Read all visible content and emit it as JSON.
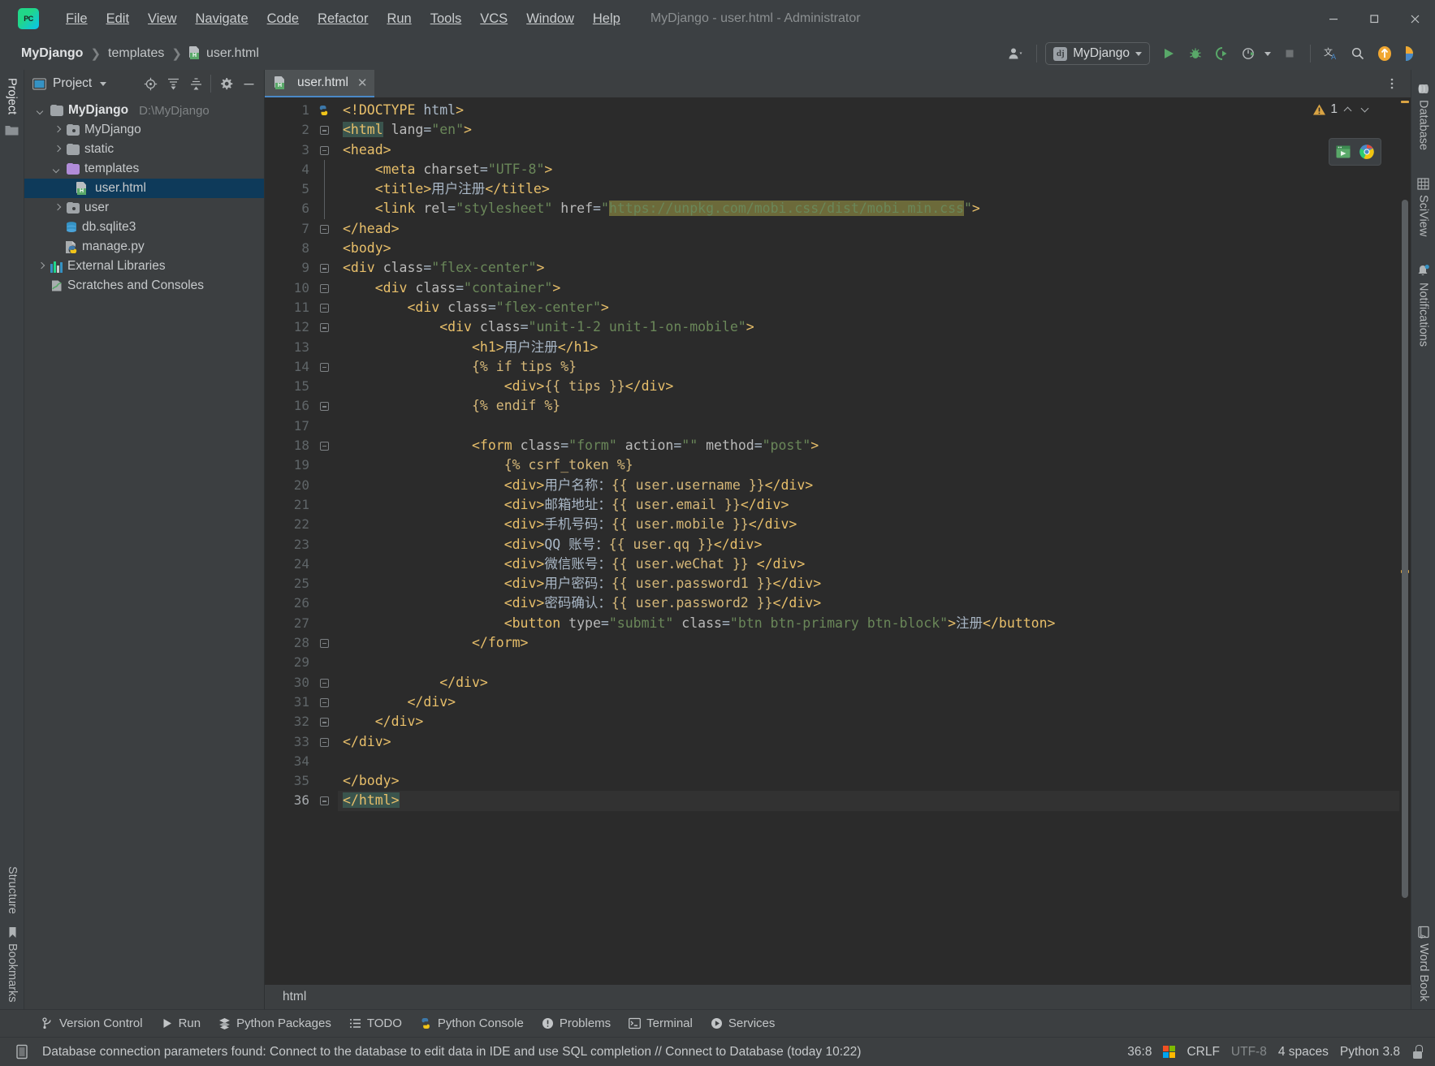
{
  "window": {
    "title": "MyDjango - user.html - Administrator",
    "app_logo": "PC",
    "minimize": "—",
    "maximize": "☐",
    "close": "✕"
  },
  "menu": [
    {
      "label": "File"
    },
    {
      "label": "Edit"
    },
    {
      "label": "View"
    },
    {
      "label": "Navigate"
    },
    {
      "label": "Code"
    },
    {
      "label": "Refactor"
    },
    {
      "label": "Run"
    },
    {
      "label": "Tools"
    },
    {
      "label": "VCS"
    },
    {
      "label": "Window"
    },
    {
      "label": "Help"
    }
  ],
  "breadcrumbs": {
    "project": "MyDjango",
    "folder": "templates",
    "file": "user.html",
    "separator": "❯"
  },
  "toolbar": {
    "run_config": "MyDjango",
    "run_config_icon": "dj",
    "account_icon": "account-icon",
    "run_icon": "run-icon",
    "debug_icon": "debug-icon",
    "coverage_icon": "run-with-coverage-icon",
    "profile_icon": "profile-icon",
    "stop_icon": "stop-icon",
    "translate_icon": "translate-icon",
    "search_icon": "search-everywhere-icon",
    "update_icon": "update-project-icon",
    "ide_icon": "ide-features-icon"
  },
  "left_strip": {
    "project_tab": "Project",
    "bookmarks_tab": "Bookmarks",
    "structure_tab": "Structure"
  },
  "right_strip": {
    "database_tab": "Database",
    "sciview_tab": "SciView",
    "notifications_tab": "Notifications",
    "wordbook_tab": "Word Book"
  },
  "project_panel": {
    "title": "Project",
    "icons": [
      "locate-icon",
      "expand-all-icon",
      "collapse-all-icon",
      "settings-gear-icon",
      "hide-icon"
    ],
    "tree": [
      {
        "label": "MyDjango",
        "path": "D:\\MyDjango",
        "indent": 0,
        "arrow": "down",
        "icon": "folder",
        "bold": true,
        "selected": false
      },
      {
        "label": "MyDjango",
        "path": "",
        "indent": 1,
        "arrow": "right",
        "icon": "folder-module",
        "bold": false,
        "selected": false
      },
      {
        "label": "static",
        "path": "",
        "indent": 1,
        "arrow": "right",
        "icon": "folder",
        "bold": false,
        "selected": false
      },
      {
        "label": "templates",
        "path": "",
        "indent": 1,
        "arrow": "down",
        "icon": "folder-templates",
        "bold": false,
        "selected": false
      },
      {
        "label": "user.html",
        "path": "",
        "indent": 2,
        "arrow": "none",
        "icon": "html-file",
        "bold": false,
        "selected": true
      },
      {
        "label": "user",
        "path": "",
        "indent": 1,
        "arrow": "right",
        "icon": "folder-module",
        "bold": false,
        "selected": false
      },
      {
        "label": "db.sqlite3",
        "path": "",
        "indent": 2,
        "arrow": "none",
        "icon": "database-file",
        "bold": false,
        "selected": false
      },
      {
        "label": "manage.py",
        "path": "",
        "indent": 2,
        "arrow": "none",
        "icon": "python-file",
        "bold": false,
        "selected": false
      },
      {
        "label": "External Libraries",
        "path": "",
        "indent": 0,
        "arrow": "right",
        "icon": "library",
        "bold": false,
        "selected": false
      },
      {
        "label": "Scratches and Consoles",
        "path": "",
        "indent": 0,
        "arrow": "none",
        "icon": "scratches",
        "bold": false,
        "selected": false
      }
    ]
  },
  "editor": {
    "tab_label": "user.html",
    "tab_close": "✕",
    "more_icon": "more-vertical-icon",
    "warning_icon": "warning-triangle-icon",
    "warning_count": "1",
    "prev_icon": "chevron-up-icon",
    "next_icon": "chevron-down-icon",
    "preview_icon": "preview-in-browser-icon",
    "chrome_icon": "chrome-icon",
    "footer_breadcrumb": "html",
    "total_lines": 36,
    "cursor_line": 36,
    "lines": [
      {
        "n": 1,
        "html": "<span class=\"tag\">&lt;!DOCTYPE</span> <span class=\"txt\">html</span><span class=\"tag\">&gt;</span>"
      },
      {
        "n": 2,
        "html": "<span class=\"sel-hl tag\">&lt;html</span> <span class=\"attr\">lang</span><span class=\"txt\">=</span><span class=\"attrv\">\"en\"</span><span class=\"tag\">&gt;</span>"
      },
      {
        "n": 3,
        "html": "<span class=\"tag\">&lt;head&gt;</span>"
      },
      {
        "n": 4,
        "html": "    <span class=\"tag\">&lt;meta</span> <span class=\"attr\">charset</span><span class=\"txt\">=</span><span class=\"attrv\">\"UTF-8\"</span><span class=\"tag\">&gt;</span>"
      },
      {
        "n": 5,
        "html": "    <span class=\"tag\">&lt;title&gt;</span><span class=\"txt\">用户注册</span><span class=\"tag\">&lt;/title&gt;</span>"
      },
      {
        "n": 6,
        "html": "    <span class=\"tag\">&lt;link</span> <span class=\"attr\">rel</span><span class=\"txt\">=</span><span class=\"attrv\">\"stylesheet\"</span> <span class=\"attr\">href</span><span class=\"txt\">=</span><span class=\"attrv\">\"</span><span class=\"url-hl\">https://unpkg.com/mobi.css/dist/mobi.min.css</span><span class=\"attrv\">\"</span><span class=\"tag\">&gt;</span>"
      },
      {
        "n": 7,
        "html": "<span class=\"tag\">&lt;/head&gt;</span>"
      },
      {
        "n": 8,
        "html": "<span class=\"tag\">&lt;body&gt;</span>"
      },
      {
        "n": 9,
        "html": "<span class=\"tag\">&lt;div</span> <span class=\"attr\">class</span><span class=\"txt\">=</span><span class=\"attrv\">\"flex-center\"</span><span class=\"tag\">&gt;</span>"
      },
      {
        "n": 10,
        "html": "    <span class=\"tag\">&lt;div</span> <span class=\"attr\">class</span><span class=\"txt\">=</span><span class=\"attrv\">\"container\"</span><span class=\"tag\">&gt;</span>"
      },
      {
        "n": 11,
        "html": "        <span class=\"tag\">&lt;div</span> <span class=\"attr\">class</span><span class=\"txt\">=</span><span class=\"attrv\">\"flex-center\"</span><span class=\"tag\">&gt;</span>"
      },
      {
        "n": 12,
        "html": "            <span class=\"tag\">&lt;div</span> <span class=\"attr\">class</span><span class=\"txt\">=</span><span class=\"attrv\">\"unit-1-2 unit-1-on-mobile\"</span><span class=\"tag\">&gt;</span>"
      },
      {
        "n": 13,
        "html": "                <span class=\"tag\">&lt;h1&gt;</span><span class=\"txt\">用户注册</span><span class=\"tag\">&lt;/h1&gt;</span>"
      },
      {
        "n": 14,
        "html": "                <span class=\"dj\">{% if tips %}</span>"
      },
      {
        "n": 15,
        "html": "                    <span class=\"tag\">&lt;div&gt;</span><span class=\"dj\">{{ tips }}</span><span class=\"tag\">&lt;/div&gt;</span>"
      },
      {
        "n": 16,
        "html": "                <span class=\"dj\">{% endif %}</span>"
      },
      {
        "n": 17,
        "html": ""
      },
      {
        "n": 18,
        "html": "                <span class=\"tag\">&lt;form</span> <span class=\"attr\">class</span><span class=\"txt\">=</span><span class=\"attrv\">\"form\"</span> <span class=\"attr\">action</span><span class=\"txt\">=</span><span class=\"attrv\">\"\"</span> <span class=\"attr\">method</span><span class=\"txt\">=</span><span class=\"attrv\">\"post\"</span><span class=\"tag\">&gt;</span>"
      },
      {
        "n": 19,
        "html": "                    <span class=\"dj\">{% csrf_token %}</span>"
      },
      {
        "n": 20,
        "html": "                    <span class=\"tag\">&lt;div&gt;</span><span class=\"txt\">用户名称：</span><span class=\"dj\">{{ user.username }}</span><span class=\"tag\">&lt;/div&gt;</span>"
      },
      {
        "n": 21,
        "html": "                    <span class=\"tag\">&lt;div&gt;</span><span class=\"txt\">邮箱地址：</span><span class=\"dj\">{{ user.email }}</span><span class=\"tag\">&lt;/div&gt;</span>"
      },
      {
        "n": 22,
        "html": "                    <span class=\"tag\">&lt;div&gt;</span><span class=\"txt\">手机号码：</span><span class=\"dj\">{{ user.mobile }}</span><span class=\"tag\">&lt;/div&gt;</span>"
      },
      {
        "n": 23,
        "html": "                    <span class=\"tag\">&lt;div&gt;</span><span class=\"txt\">QQ 账号：</span><span class=\"dj\">{{ user.qq }}</span><span class=\"tag\">&lt;/div&gt;</span>"
      },
      {
        "n": 24,
        "html": "                    <span class=\"tag\">&lt;div&gt;</span><span class=\"txt\">微信账号：</span><span class=\"dj\">{{ user.weChat }}</span><span class=\"txt\"> </span><span class=\"tag\">&lt;/div&gt;</span>"
      },
      {
        "n": 25,
        "html": "                    <span class=\"tag\">&lt;div&gt;</span><span class=\"txt\">用户密码：</span><span class=\"dj\">{{ user.password1 }}</span><span class=\"tag\">&lt;/div&gt;</span>"
      },
      {
        "n": 26,
        "html": "                    <span class=\"tag\">&lt;div&gt;</span><span class=\"txt\">密码确认：</span><span class=\"dj\">{{ user.password2 }}</span><span class=\"tag\">&lt;/div&gt;</span>"
      },
      {
        "n": 27,
        "html": "                    <span class=\"tag\">&lt;button</span> <span class=\"attr\">type</span><span class=\"txt\">=</span><span class=\"attrv\">\"submit\"</span> <span class=\"attr\">class</span><span class=\"txt\">=</span><span class=\"attrv\">\"btn btn-primary btn-block\"</span><span class=\"tag\">&gt;</span><span class=\"txt\">注册</span><span class=\"tag\">&lt;/button&gt;</span>"
      },
      {
        "n": 28,
        "html": "                <span class=\"tag\">&lt;/form&gt;</span>"
      },
      {
        "n": 29,
        "html": ""
      },
      {
        "n": 30,
        "html": "            <span class=\"tag\">&lt;/div&gt;</span>"
      },
      {
        "n": 31,
        "html": "        <span class=\"tag\">&lt;/div&gt;</span>"
      },
      {
        "n": 32,
        "html": "    <span class=\"tag\">&lt;/div&gt;</span>"
      },
      {
        "n": 33,
        "html": "<span class=\"tag\">&lt;/div&gt;</span>"
      },
      {
        "n": 34,
        "html": ""
      },
      {
        "n": 35,
        "html": "<span class=\"tag\">&lt;/body&gt;</span>"
      },
      {
        "n": 36,
        "html": "<span class=\"sel-hl tag\">&lt;/html&gt;</span>"
      }
    ]
  },
  "tool_windows": [
    {
      "label": "Version Control",
      "icon": "branch-icon"
    },
    {
      "label": "Run",
      "icon": "run-icon"
    },
    {
      "label": "Python Packages",
      "icon": "packages-icon"
    },
    {
      "label": "TODO",
      "icon": "todo-list-icon"
    },
    {
      "label": "Python Console",
      "icon": "python-console-icon"
    },
    {
      "label": "Problems",
      "icon": "problems-icon"
    },
    {
      "label": "Terminal",
      "icon": "terminal-icon"
    },
    {
      "label": "Services",
      "icon": "services-icon"
    }
  ],
  "status_bar": {
    "db_icon": "database-inspect-icon",
    "message": "Database connection parameters found: Connect to the database to edit data in IDE and use SQL completion // Connect to Database (today 10:22)",
    "caret_position": "36:8",
    "os_icon": "windows-logo-icon",
    "line_separator": "CRLF",
    "encoding": "UTF-8",
    "indent": "4 spaces",
    "interpreter": "Python 3.8",
    "lock_icon": "read-only-lock-icon"
  },
  "colors": {
    "accent_blue": "#4a88c7",
    "selection_bg": "#0e3a5a",
    "editor_bg": "#2b2b2b",
    "panel_bg": "#3c3f41",
    "tag_orange": "#e8bf6a",
    "string_green": "#6a8759",
    "django_tan": "#d5b778",
    "warn_yellow": "#d9a343",
    "run_green": "#59a869",
    "templates_purple": "#b18cd9"
  }
}
